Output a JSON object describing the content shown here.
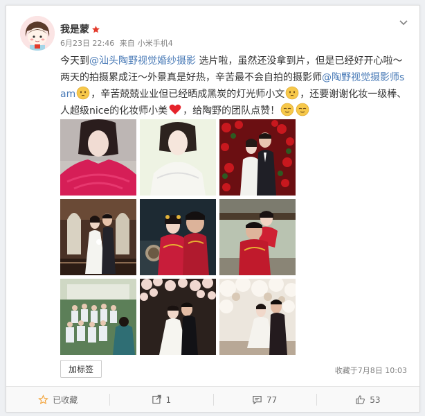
{
  "post": {
    "user_name": "我是蒙",
    "date": "6月23日 22:46",
    "source_prefix": "来自",
    "device": "小米手机4",
    "text": {
      "p1": "今天到",
      "link1": "@汕头陶野视觉婚纱摄影",
      "p2": " 选片啦，虽然还没拿到片，但是已经好开心啦～两天的拍摄累成汪～外景真是好热，辛苦最不会自拍的摄影师",
      "link2": "@陶野视觉摄影师sam",
      "p3": "，辛苦兢兢业业但已经晒成黑炭的灯光师小文",
      "p4": "，还要谢谢化妆一级棒、人超级nice的化妆师小美",
      "p5": "，给陶野的团队点赞！"
    },
    "photos": [
      {
        "name": "photo-1",
        "desc": "woman-red-lace"
      },
      {
        "name": "photo-2",
        "desc": "woman-white-dress"
      },
      {
        "name": "photo-3",
        "desc": "couple-red-roses"
      },
      {
        "name": "photo-4",
        "desc": "couple-church"
      },
      {
        "name": "photo-5",
        "desc": "couple-chinese-red"
      },
      {
        "name": "photo-6",
        "desc": "couple-piggyback"
      },
      {
        "name": "photo-7",
        "desc": "group-photo"
      },
      {
        "name": "photo-8",
        "desc": "couple-blossom"
      },
      {
        "name": "photo-9",
        "desc": "couple-white-blossom"
      }
    ]
  },
  "tag_button": "加标签",
  "fav_time": "收藏于7月8日 10:03",
  "actions": {
    "favorite": "已收藏",
    "repost": "1",
    "comment": "77",
    "like": "53"
  },
  "colors": {
    "link": "#4a7bb7",
    "background": "#eef0f3",
    "star_orange": "#f3a339",
    "badge_red": "#e33a2b"
  },
  "icons": {
    "verified_badge": "red-star-icon",
    "menu": "chevron-down-icon",
    "favorite": "star-icon",
    "repost": "repost-icon",
    "comment": "comment-icon",
    "like": "thumbs-up-icon"
  }
}
